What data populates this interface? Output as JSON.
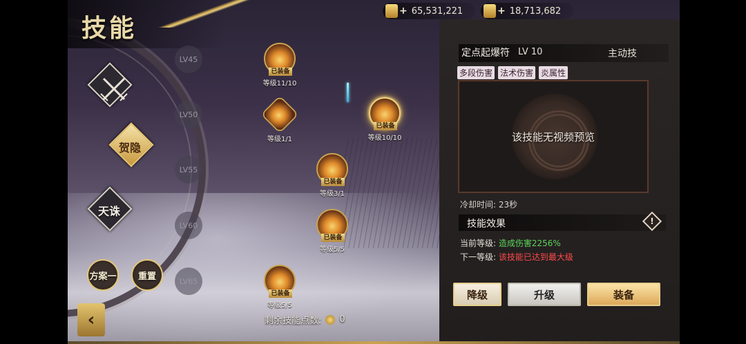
{
  "header": {
    "title": "技能"
  },
  "currency": [
    {
      "icon": "gold-ingot-icon",
      "amount": "65,531,221"
    },
    {
      "icon": "gold-coupon-icon",
      "amount": "18,713,682"
    }
  ],
  "schools": [
    {
      "label": "",
      "icon": "crossed-blades-icon",
      "active": false
    },
    {
      "label": "贺隐",
      "active": true
    },
    {
      "label": "天诛",
      "active": false
    }
  ],
  "plans": {
    "plan_label": "方案一",
    "reset_label": "重置"
  },
  "back": {
    "glyph": "‹"
  },
  "levels": [
    "LV45",
    "LV50",
    "LV55",
    "LV60",
    "LV65"
  ],
  "skill_nodes": [
    {
      "equipped": "已装备",
      "level": "等级11/10"
    },
    {
      "equipped": "",
      "level": "等级1/1"
    },
    {
      "equipped": "已装备",
      "level": "等级10/10"
    },
    {
      "equipped": "已装备",
      "level": "等级3/1"
    },
    {
      "equipped": "已装备",
      "level": "等级5/5"
    },
    {
      "equipped": "已装备",
      "level": "等级5/5"
    }
  ],
  "points": {
    "label": "剩余技能点数:",
    "value": "0"
  },
  "detail": {
    "name": "定点起爆符",
    "level": "LV 10",
    "type": "主动技",
    "tags": [
      "多段伤害",
      "法术伤害",
      "炎属性"
    ],
    "preview_text": "该技能无视频预览",
    "cooldown": "冷却时间: 23秒",
    "effect_title": "技能效果",
    "warn_glyph": "!",
    "current_label": "当前等级:",
    "current_value": "造成伤害2256%",
    "next_label": "下一等级:",
    "next_value": "该技能已达到最大级"
  },
  "actions": {
    "downgrade": "降级",
    "upgrade": "升级",
    "equip": "装备"
  }
}
